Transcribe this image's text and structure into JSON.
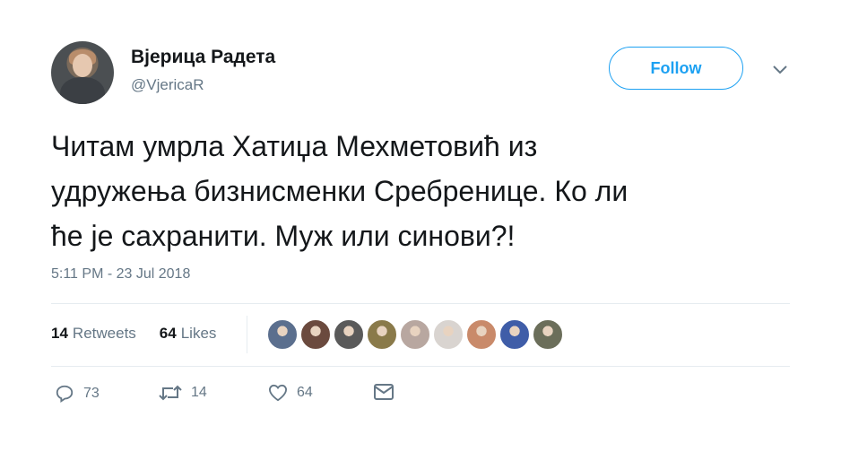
{
  "user": {
    "name": "Вјерица Радета",
    "handle": "@VjericaR"
  },
  "follow_label": "Follow",
  "tweet_lines": [
    "Читам умрла Хатиџа Мехметовић из",
    "удружења бизнисменки Сребренице. Ко ли",
    "ће је сахранити. Муж или синови?!"
  ],
  "timestamp": "5:11 PM - 23 Jul 2018",
  "stats": {
    "retweets_count": "14",
    "retweets_label": "Retweets",
    "likes_count": "64",
    "likes_label": "Likes"
  },
  "actions": {
    "replies": "73",
    "retweets": "14",
    "likes": "64"
  },
  "liker_colors": [
    "#5b6f8e",
    "#6b4a3e",
    "#5a5a5a",
    "#8a7a4a",
    "#b8a7a0",
    "#d9d4d0",
    "#c98a6a",
    "#3f5da8",
    "#6b6e5a"
  ],
  "colors": {
    "accent": "#1da1f2",
    "text": "#14171a",
    "muted": "#657786"
  }
}
